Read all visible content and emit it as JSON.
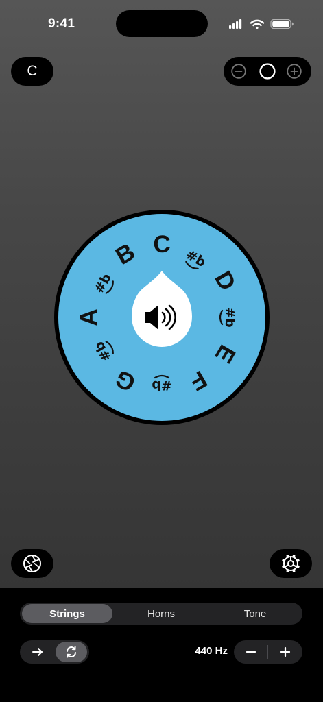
{
  "status_bar": {
    "time": "9:41"
  },
  "key_selector": {
    "label": "C"
  },
  "volume_control": {
    "minus_icon": "minus-circle-icon",
    "level_icon": "circle-icon",
    "plus_icon": "plus-circle-icon"
  },
  "pitch_wheel": {
    "fill_color": "#5BB8E3",
    "ring_color": "#000000",
    "center_color": "#FFFFFF",
    "center_icon": "speaker-icon",
    "notes": [
      "C",
      "D",
      "E",
      "F",
      "G",
      "A",
      "B"
    ],
    "accidentals": [
      "#b",
      "#b",
      "#b",
      "#b",
      "#b"
    ]
  },
  "bottom_buttons": {
    "left_icon": "aperture-icon",
    "right_icon": "gear-icon"
  },
  "mode_tabs": {
    "items": [
      "Strings",
      "Horns",
      "Tone"
    ],
    "selected": "Strings"
  },
  "direction_toggle": {
    "items": [
      "arrow-right-icon",
      "repeat-icon"
    ],
    "selected": "repeat-icon"
  },
  "tuning": {
    "frequency": "440 Hz",
    "minus_label": "−",
    "plus_label": "+"
  }
}
